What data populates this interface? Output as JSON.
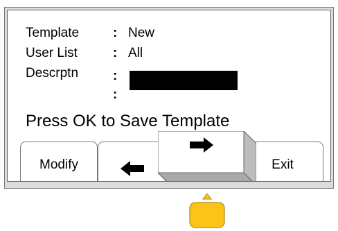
{
  "screen": {
    "fields": [
      {
        "label": "Template",
        "separator": ":",
        "value": "New"
      },
      {
        "label": "User List",
        "separator": ":",
        "value": "All"
      },
      {
        "label": "Descrptn",
        "separator": ":",
        "value": ""
      },
      {
        "label": "",
        "separator": ":",
        "value": ""
      }
    ],
    "prompt": "Press OK to Save Template"
  },
  "softkeys": {
    "modify": "Modify",
    "left_icon": "left-arrow-icon",
    "right_icon": "right-arrow-icon",
    "exit": "Exit"
  },
  "indicator": {
    "icon": "up-triangle-icon",
    "color": "#fcc419"
  },
  "colors": {
    "frame": "#dcdcdc",
    "screen_bg": "#ffffff",
    "text": "#000000",
    "highlight": "#000000"
  }
}
